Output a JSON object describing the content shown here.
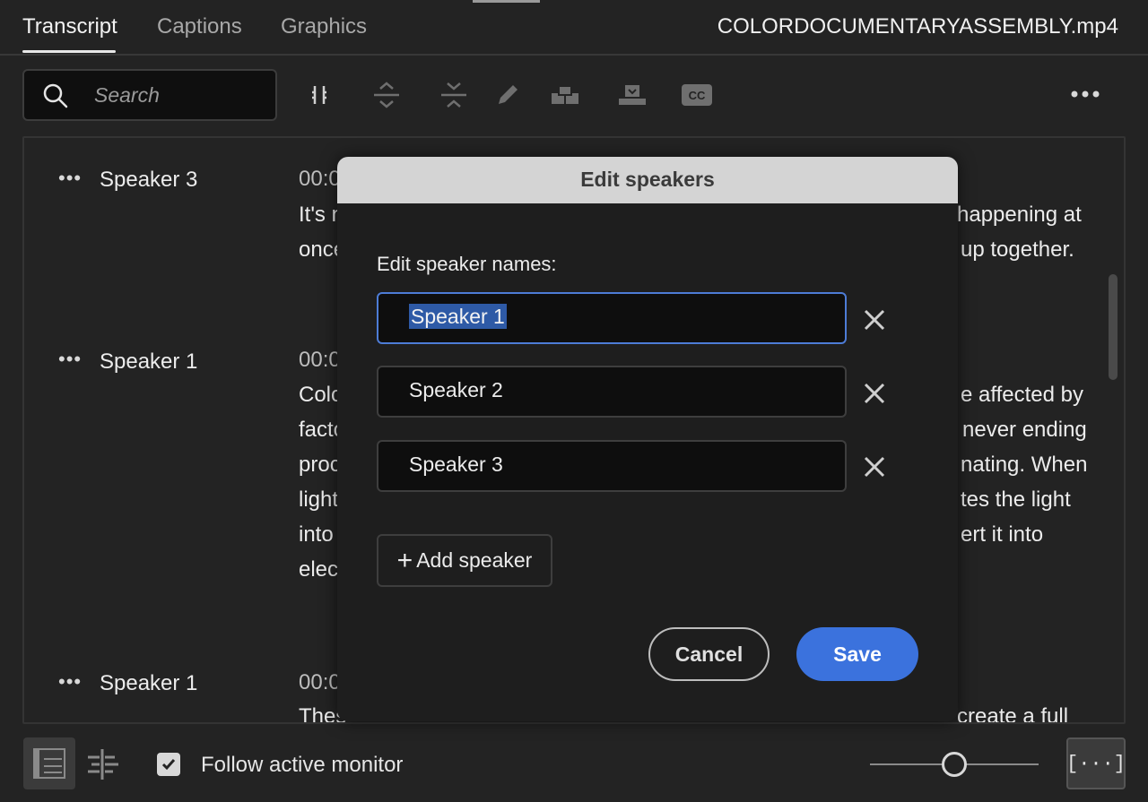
{
  "tabs": [
    {
      "label": "Transcript",
      "active": true
    },
    {
      "label": "Captions",
      "active": false
    },
    {
      "label": "Graphics",
      "active": false
    }
  ],
  "file_title": "COLORDOCUMENTARYASSEMBLY.mp4",
  "search": {
    "placeholder": "Search"
  },
  "toolbar_icons": [
    "merge-segments-icon",
    "expand-icon",
    "collapse-icon",
    "pencil-icon",
    "insert-icon",
    "overwrite-icon",
    "captions-cc-icon",
    "more-options-icon"
  ],
  "toolbar": {
    "cc_label": "CC"
  },
  "transcript": [
    {
      "speaker": "Speaker 3",
      "timestamp": "00:0",
      "left_lines": [
        "It's n",
        "once"
      ],
      "right_lines": [
        "happening at",
        "up together."
      ]
    },
    {
      "speaker": "Speaker 1",
      "timestamp": "00:0",
      "left_lines": [
        "Colo",
        "facto",
        "proc",
        "light",
        "into",
        "elec"
      ],
      "right_lines": [
        "e affected by",
        "never ending",
        "nating. When",
        "tes the light",
        "ert it into",
        ""
      ]
    },
    {
      "speaker": "Speaker 1",
      "timestamp": "00:0",
      "left_lines": [
        "Thes"
      ],
      "right_lines": [
        "create a full"
      ]
    }
  ],
  "dialog": {
    "title": "Edit speakers",
    "label": "Edit speaker names:",
    "speakers": [
      "Speaker 1",
      "Speaker 2",
      "Speaker 3"
    ],
    "add_label": "Add speaker",
    "cancel_label": "Cancel",
    "save_label": "Save"
  },
  "bottom": {
    "follow_label": "Follow active monitor",
    "follow_checked": true,
    "brackets_label": "[···]"
  },
  "colors": {
    "accent": "#3b72dd",
    "focus": "#4d7cd6",
    "bg": "#232323"
  }
}
